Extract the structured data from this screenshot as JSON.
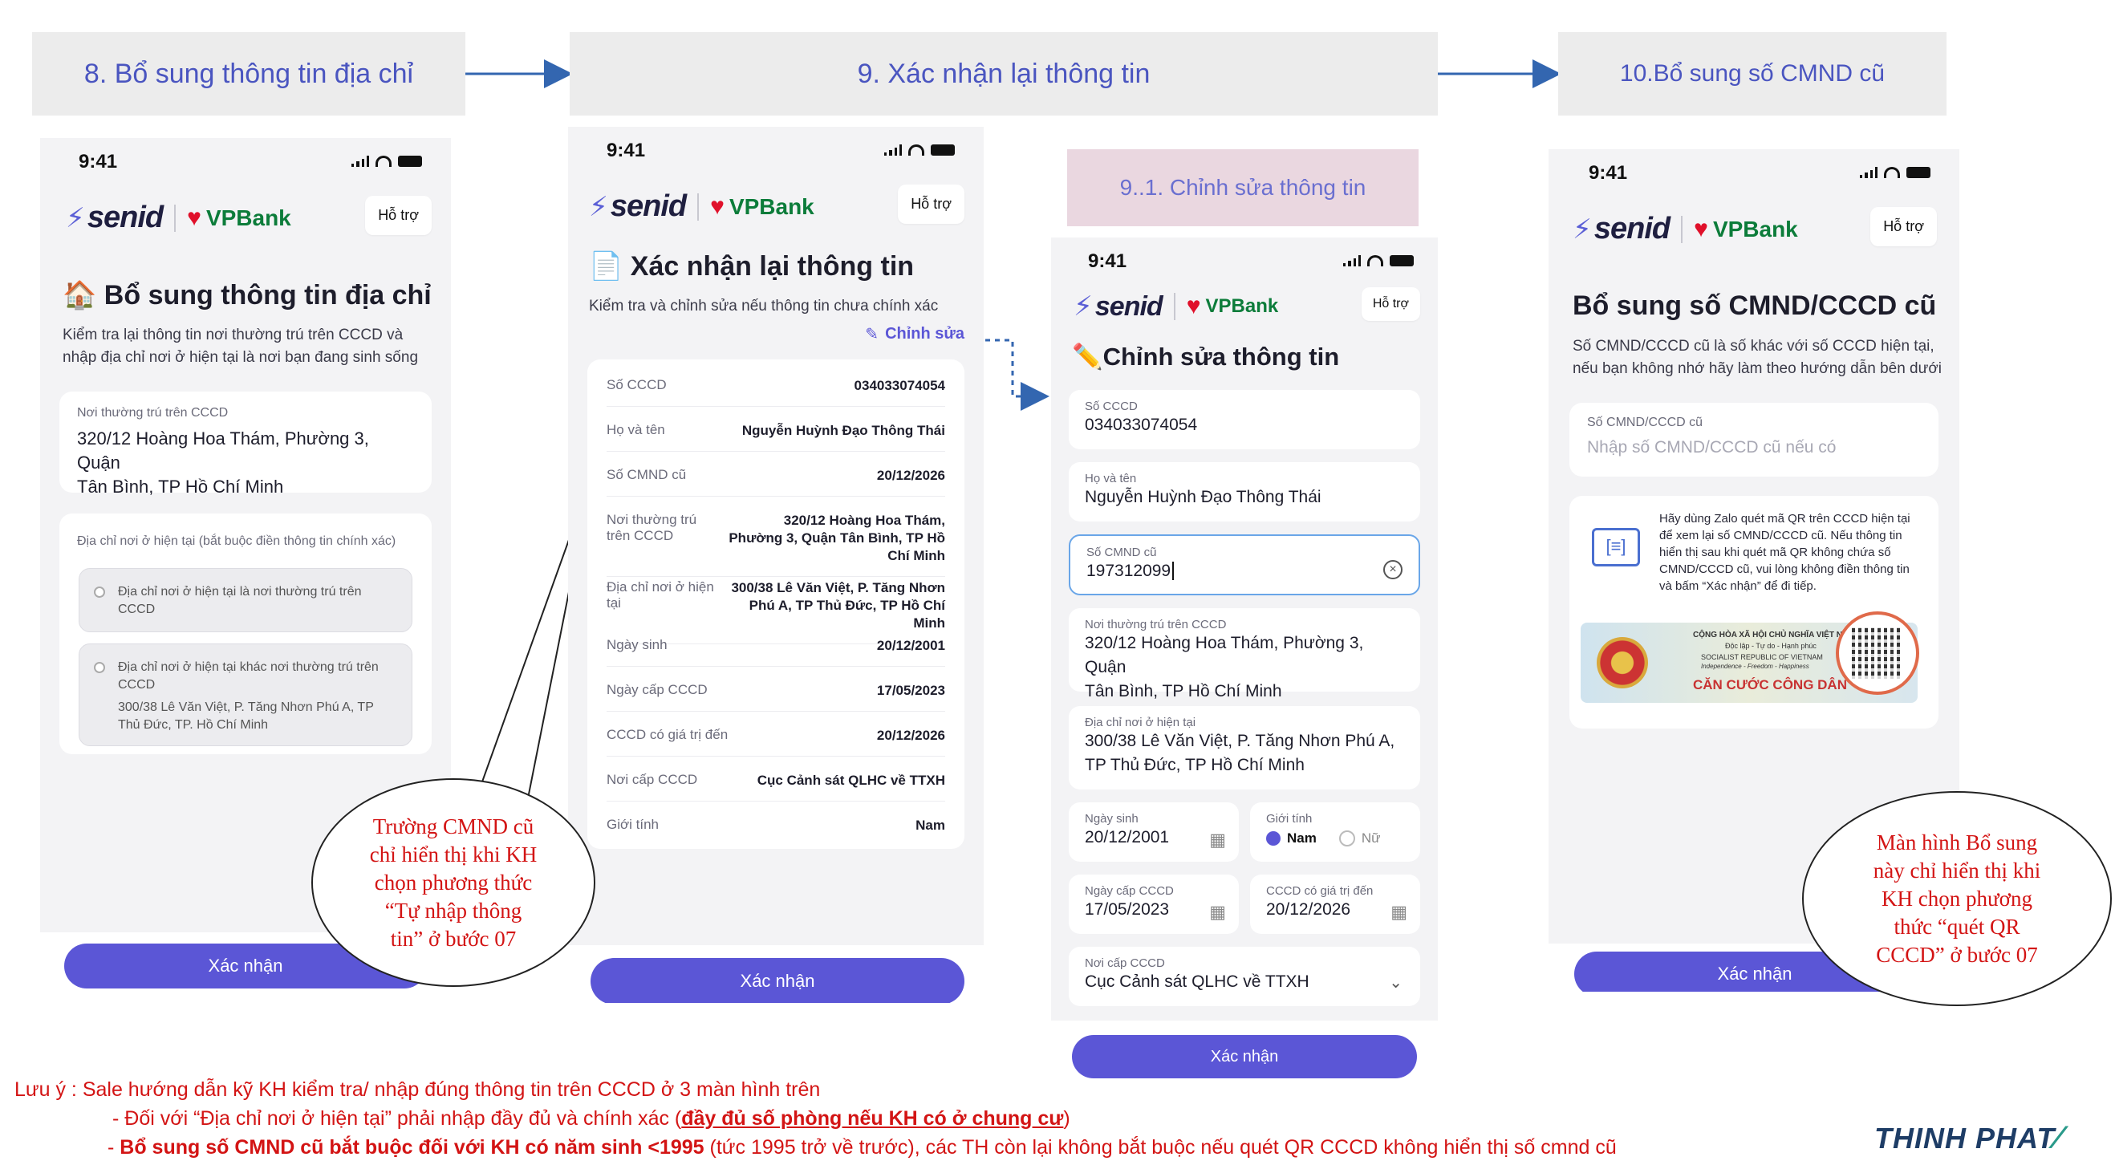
{
  "steps": {
    "s8": "8.  Bổ sung thông tin địa chỉ",
    "s9": "9.  Xác nhận lại thông tin",
    "s91": "9..1. Chỉnh sửa thông tin",
    "s10": "10.Bổ sung số CMND cũ"
  },
  "common": {
    "time": "9:41",
    "brand": "senid",
    "bank": "VPBank",
    "support": "Hỗ trợ",
    "confirm": "Xác nhận"
  },
  "screen8": {
    "title": "Bổ sung thông tin địa chỉ",
    "sub1": "Kiểm tra lại thông tin nơi thường trú trên CCCD và",
    "sub2": "nhập địa chỉ nơi ở hiện tại là nơi bạn đang sinh sống",
    "perm_label": "Nơi thường trú trên CCCD",
    "perm_val1": "320/12 Hoàng Hoa Thám, Phường 3, Quận",
    "perm_val2": "Tân Bình, TP Hồ Chí Minh",
    "cur_label": "Địa chỉ nơi ở hiện tại (bắt buộc điền thông tin chính xác)",
    "opt1": "Địa chỉ nơi ở hiện tại là nơi thường trú trên CCCD",
    "opt2": "Địa chỉ nơi ở hiện tại khác nơi thường trú trên CCCD",
    "opt2_addr": "300/38 Lê Văn Việt, P. Tăng Nhơn Phú A, TP Thủ Đức, TP. Hồ Chí Minh"
  },
  "screen9": {
    "title": "Xác nhận lại thông tin",
    "sub": "Kiểm tra và chỉnh sửa nếu thông tin chưa chính xác",
    "edit": "Chỉnh sửa",
    "rows": [
      {
        "k": "Số CCCD",
        "v": "034033074054"
      },
      {
        "k": "Họ và tên",
        "v": "Nguyễn Huỳnh Đạo Thông Thái"
      },
      {
        "k": "Số CMND cũ",
        "v": "20/12/2026"
      },
      {
        "k": "Nơi thường trú trên CCCD",
        "v": "320/12 Hoàng Hoa Thám, Phường 3, Quận Tân Bình, TP Hồ Chí Minh"
      },
      {
        "k": "Địa chỉ nơi ở hiện tại",
        "v": "300/38 Lê Văn Việt, P. Tăng Nhơn Phú A, TP Thủ Đức, TP Hồ Chí Minh"
      },
      {
        "k": "Ngày sinh",
        "v": "20/12/2001"
      },
      {
        "k": "Ngày cấp CCCD",
        "v": "17/05/2023"
      },
      {
        "k": "CCCD có giá trị đến",
        "v": "20/12/2026"
      },
      {
        "k": "Nơi cấp CCCD",
        "v": "Cục Cảnh sát QLHC về TTXH"
      },
      {
        "k": "Giới tính",
        "v": "Nam"
      }
    ]
  },
  "screen91": {
    "title": "Chỉnh sửa thông tin",
    "f_cccd_l": "Số CCCD",
    "f_cccd_v": "034033074054",
    "f_name_l": "Họ và tên",
    "f_name_v": "Nguyễn Huỳnh Đạo Thông Thái",
    "f_cmnd_l": "Số CMND cũ",
    "f_cmnd_v": "197312099",
    "f_perm_l": "Nơi thường trú trên CCCD",
    "f_perm_v1": "320/12 Hoàng Hoa Thám, Phường 3, Quận",
    "f_perm_v2": "Tân Bình, TP Hồ Chí Minh",
    "f_cur_l": "Địa chỉ nơi ở hiện tại",
    "f_cur_v1": "300/38 Lê Văn Việt, P. Tăng Nhơn Phú A,",
    "f_cur_v2": "TP Thủ Đức, TP Hồ Chí Minh",
    "f_dob_l": "Ngày sinh",
    "f_dob_v": "20/12/2001",
    "f_sex_l": "Giới tính",
    "f_sex_m": "Nam",
    "f_sex_f": "Nữ",
    "f_issue_l": "Ngày cấp CCCD",
    "f_issue_v": "17/05/2023",
    "f_exp_l": "CCCD có giá trị đến",
    "f_exp_v": "20/12/2026",
    "f_place_l": "Nơi cấp CCCD",
    "f_place_v": "Cục Cảnh sát QLHC về TTXH"
  },
  "screen10": {
    "title": "Bổ sung số CMND/CCCD cũ",
    "sub1": "Số CMND/CCCD cũ là số khác với số CCCD hiện tại,",
    "sub2": "nếu bạn không nhớ hãy làm theo hướng dẫn bên dưới",
    "field_label": "Số CMND/CCCD cũ",
    "placeholder": "Nhập số CMND/CCCD cũ nếu có",
    "guide": "Hãy dùng Zalo quét mã QR trên CCCD hiện tại để xem lại số CMND/CCCD cũ. Nếu thông tin hiển thị sau khi quét mã QR không chứa số CMND/CCCD cũ, vui lòng không điền thông tin và bấm “Xác nhận” để đi tiếp.",
    "card_top": "CỘNG HÒA XÃ HỘI CHỦ NGHĨA VIỆT NAM",
    "card_mid": "Độc lập - Tự do - Hạnh phúc",
    "card_en": "SOCIALIST REPUBLIC OF VIETNAM",
    "card_en2": "Independence - Freedom - Happiness",
    "card_title": "CĂN CƯỚC CÔNG DÂN"
  },
  "callouts": {
    "c1": "Trường CMND cũ chỉ hiển thị khi KH chọn phương thức “Tự nhập thông tin” ở bước 07",
    "c2": "Màn hình Bổ sung này chỉ hiển thị khi KH chọn phương thức “quét QR CCCD” ở bước 07"
  },
  "notes": {
    "n1": "Lưu ý : Sale hướng dẫn kỹ KH kiểm tra/ nhập đúng thông tin trên CCCD ở 3 màn hình trên",
    "n2a": "- Đối với “Địa chỉ nơi ở hiện tại” phải nhập đầy đủ và chính xác (",
    "n2b": "đầy đủ số phòng nếu KH có ở chung cư",
    "n2c": ")",
    "n3a": "- ",
    "n3b": "Bổ sung số CMND cũ bắt buộc đối với KH có năm sinh <1995",
    "n3c": " (tức 1995 trở về trước), các TH còn lại không bắt buộc nếu quét QR CCCD không hiển thị số cmnd cũ"
  },
  "logo": "THINH PHAT",
  "colors": {
    "accent": "#5b56d6",
    "note": "#d31414",
    "step_text": "#4a55c0"
  }
}
